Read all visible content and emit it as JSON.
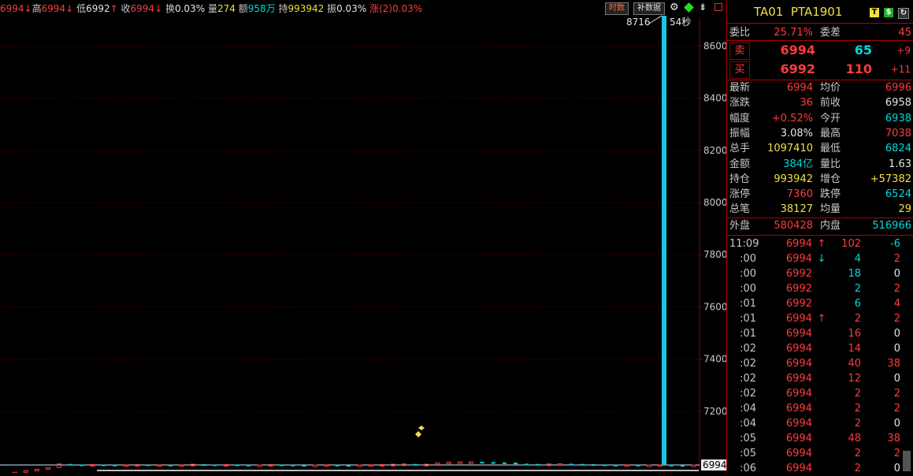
{
  "header": {
    "prefix": "6994",
    "prefix_arrow": "↓",
    "high_label": "高",
    "high": "6994",
    "high_arrow": "↓",
    "low_label": "低",
    "low": "6992",
    "low_arrow": "↑",
    "close_label": "收",
    "close": "6994",
    "close_arrow": "↓",
    "turnover_label": "换",
    "turnover": "0.03%",
    "volume_label": "量",
    "volume": "274",
    "amount_label": "额",
    "amount": "958万",
    "open_int_label": "持",
    "open_int": "993942",
    "amplitude_label": "振",
    "amplitude": "0.03%",
    "change_label": "涨",
    "change": "(2)",
    "change_pct": "0.03%"
  },
  "toolbar": {
    "time_button": "时数",
    "supplement_button": "补数据"
  },
  "chart_data": {
    "type": "candlestick",
    "y_ticks": [
      8600,
      8400,
      8200,
      8000,
      7800,
      7600,
      7400,
      7200
    ],
    "ylim": [
      6970,
      8710
    ],
    "last_price_label": "6994",
    "spike_label": "8716",
    "spike_time_label": "54秒",
    "series": [
      {
        "name": "",
        "values": [
          6962,
          6966,
          6972,
          6978,
          6984,
          6998,
          6996,
          6994,
          6996,
          6995,
          6994,
          6995,
          6996,
          6994,
          6995,
          6994,
          6995,
          6997,
          6996,
          6995,
          6996,
          6995,
          6994,
          6994,
          6996,
          6995,
          6994,
          6993,
          6994,
          6995,
          6994,
          6993,
          6994,
          6995,
          6996,
          6997,
          6998,
          6996,
          6997,
          7002,
          7005,
          7006,
          7006,
          7005,
          7004,
          7003,
          6999,
          6998,
          6997,
          6998,
          6999,
          6998,
          6997,
          6996,
          6995,
          6994,
          6995,
          6993,
          6994,
          6995,
          6994,
          6993,
          6994
        ]
      }
    ],
    "spike_value": 8716
  },
  "panel": {
    "symbol": "TA01",
    "name": "PTA1901",
    "icons": [
      "T",
      "$",
      "↻"
    ],
    "weibi_label": "委比",
    "weibi": "25.71%",
    "weicha_label": "委差",
    "weicha": "45",
    "sell_label": "卖",
    "sell_price": "6994",
    "sell_vol": "65",
    "sell_chg": "+9",
    "buy_label": "买",
    "buy_price": "6992",
    "buy_vol": "110",
    "buy_chg": "+11",
    "stats": [
      {
        "l1": "最新",
        "v1": "6994",
        "c1": "red",
        "l2": "均价",
        "v2": "6996",
        "c2": "red"
      },
      {
        "l1": "涨跌",
        "v1": "36",
        "c1": "red",
        "l2": "前收",
        "v2": "6958",
        "c2": "white"
      },
      {
        "l1": "幅度",
        "v1": "+0.52%",
        "c1": "red",
        "l2": "今开",
        "v2": "6938",
        "c2": "green"
      },
      {
        "l1": "振幅",
        "v1": "3.08%",
        "c1": "white",
        "l2": "最高",
        "v2": "7038",
        "c2": "red"
      },
      {
        "l1": "总手",
        "v1": "1097410",
        "c1": "yellow",
        "l2": "最低",
        "v2": "6824",
        "c2": "green"
      },
      {
        "l1": "金额",
        "v1": "384亿",
        "c1": "green",
        "l2": "量比",
        "v2": "1.63",
        "c2": "white"
      },
      {
        "l1": "持仓",
        "v1": "993942",
        "c1": "yellow",
        "l2": "增仓",
        "v2": "+57382",
        "c2": "yellow"
      },
      {
        "l1": "涨停",
        "v1": "7360",
        "c1": "red",
        "l2": "跌停",
        "v2": "6524",
        "c2": "green"
      },
      {
        "l1": "总笔",
        "v1": "38127",
        "c1": "yellow",
        "l2": "均量",
        "v2": "29",
        "c2": "yellow"
      }
    ],
    "outer_label": "外盘",
    "outer": "580428",
    "inner_label": "内盘",
    "inner": "516966",
    "ticks": [
      {
        "t": "11:09",
        "p": "6994",
        "a": "↑",
        "ac": "red",
        "v": "102",
        "vc": "red",
        "o": "-6",
        "oc": "green"
      },
      {
        "t": ":00",
        "p": "6994",
        "a": "↓",
        "ac": "green",
        "v": "4",
        "vc": "green",
        "o": "2",
        "oc": "red"
      },
      {
        "t": ":00",
        "p": "6992",
        "a": "",
        "ac": "",
        "v": "18",
        "vc": "green",
        "o": "0",
        "oc": "white"
      },
      {
        "t": ":00",
        "p": "6992",
        "a": "",
        "ac": "",
        "v": "2",
        "vc": "green",
        "o": "2",
        "oc": "red"
      },
      {
        "t": ":01",
        "p": "6992",
        "a": "",
        "ac": "",
        "v": "6",
        "vc": "green",
        "o": "4",
        "oc": "red"
      },
      {
        "t": ":01",
        "p": "6994",
        "a": "↑",
        "ac": "red",
        "v": "2",
        "vc": "red",
        "o": "2",
        "oc": "red"
      },
      {
        "t": ":01",
        "p": "6994",
        "a": "",
        "ac": "",
        "v": "16",
        "vc": "red",
        "o": "0",
        "oc": "white"
      },
      {
        "t": ":02",
        "p": "6994",
        "a": "",
        "ac": "",
        "v": "14",
        "vc": "red",
        "o": "0",
        "oc": "white"
      },
      {
        "t": ":02",
        "p": "6994",
        "a": "",
        "ac": "",
        "v": "40",
        "vc": "red",
        "o": "38",
        "oc": "red"
      },
      {
        "t": ":02",
        "p": "6994",
        "a": "",
        "ac": "",
        "v": "12",
        "vc": "red",
        "o": "0",
        "oc": "white"
      },
      {
        "t": ":02",
        "p": "6994",
        "a": "",
        "ac": "",
        "v": "2",
        "vc": "red",
        "o": "2",
        "oc": "red"
      },
      {
        "t": ":04",
        "p": "6994",
        "a": "",
        "ac": "",
        "v": "2",
        "vc": "red",
        "o": "2",
        "oc": "red"
      },
      {
        "t": ":04",
        "p": "6994",
        "a": "",
        "ac": "",
        "v": "2",
        "vc": "red",
        "o": "0",
        "oc": "white"
      },
      {
        "t": ":05",
        "p": "6994",
        "a": "",
        "ac": "",
        "v": "48",
        "vc": "red",
        "o": "38",
        "oc": "red"
      },
      {
        "t": ":05",
        "p": "6994",
        "a": "",
        "ac": "",
        "v": "2",
        "vc": "red",
        "o": "2",
        "oc": "red"
      },
      {
        "t": ":06",
        "p": "6994",
        "a": "",
        "ac": "",
        "v": "2",
        "vc": "red",
        "o": "0",
        "oc": "white"
      }
    ]
  },
  "colors": {
    "up": "#ff3b3b",
    "down": "#00d9d9",
    "grid": "#8a0000",
    "spike": "#19c8e0"
  }
}
